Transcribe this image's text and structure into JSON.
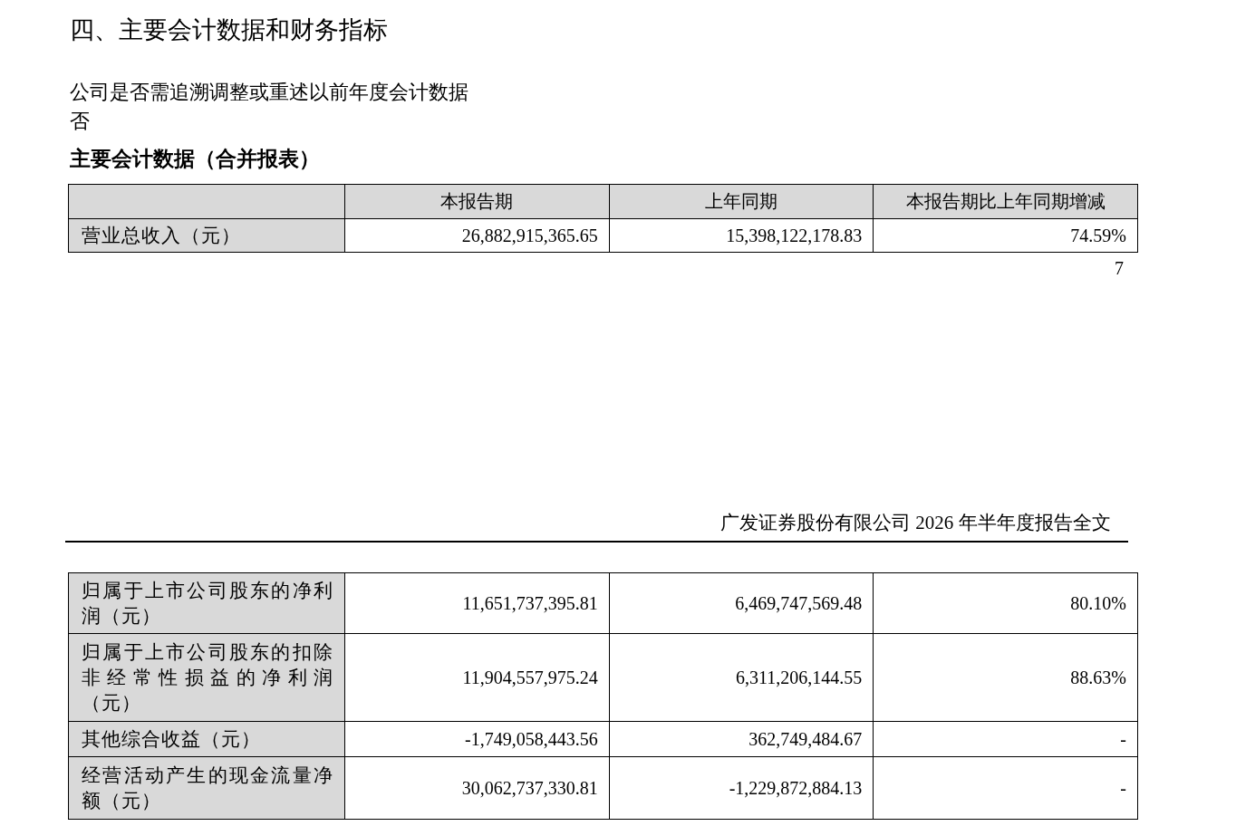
{
  "heading": "四、主要会计数据和财务指标",
  "question": "公司是否需追溯调整或重述以前年度会计数据",
  "answer": "否",
  "table_title": "主要会计数据（合并报表）",
  "table": {
    "columns": [
      "本报告期",
      "上年同期",
      "本报告期比上年同期增减"
    ],
    "rows": [
      {
        "label": "营业总收入（元）",
        "values": [
          "26,882,915,365.65",
          "15,398,122,178.83",
          "74.59%"
        ]
      }
    ]
  },
  "page_number": "7",
  "footer": "广发证券股份有限公司 2026 年半年度报告全文",
  "continued_rows": [
    {
      "label": "归属于上市公司股东的净利润（元）",
      "values": [
        "11,651,737,395.81",
        "6,469,747,569.48",
        "80.10%"
      ]
    },
    {
      "label": "归属于上市公司股东的扣除非经常性损益的净利润（元）",
      "values": [
        "11,904,557,975.24",
        "6,311,206,144.55",
        "88.63%"
      ]
    },
    {
      "label": "其他综合收益（元）",
      "values": [
        "-1,749,058,443.56",
        "362,749,484.67",
        "-"
      ]
    },
    {
      "label": "经营活动产生的现金流量净额（元）",
      "values": [
        "30,062,737,330.81",
        "-1,229,872,884.13",
        "-"
      ]
    }
  ]
}
